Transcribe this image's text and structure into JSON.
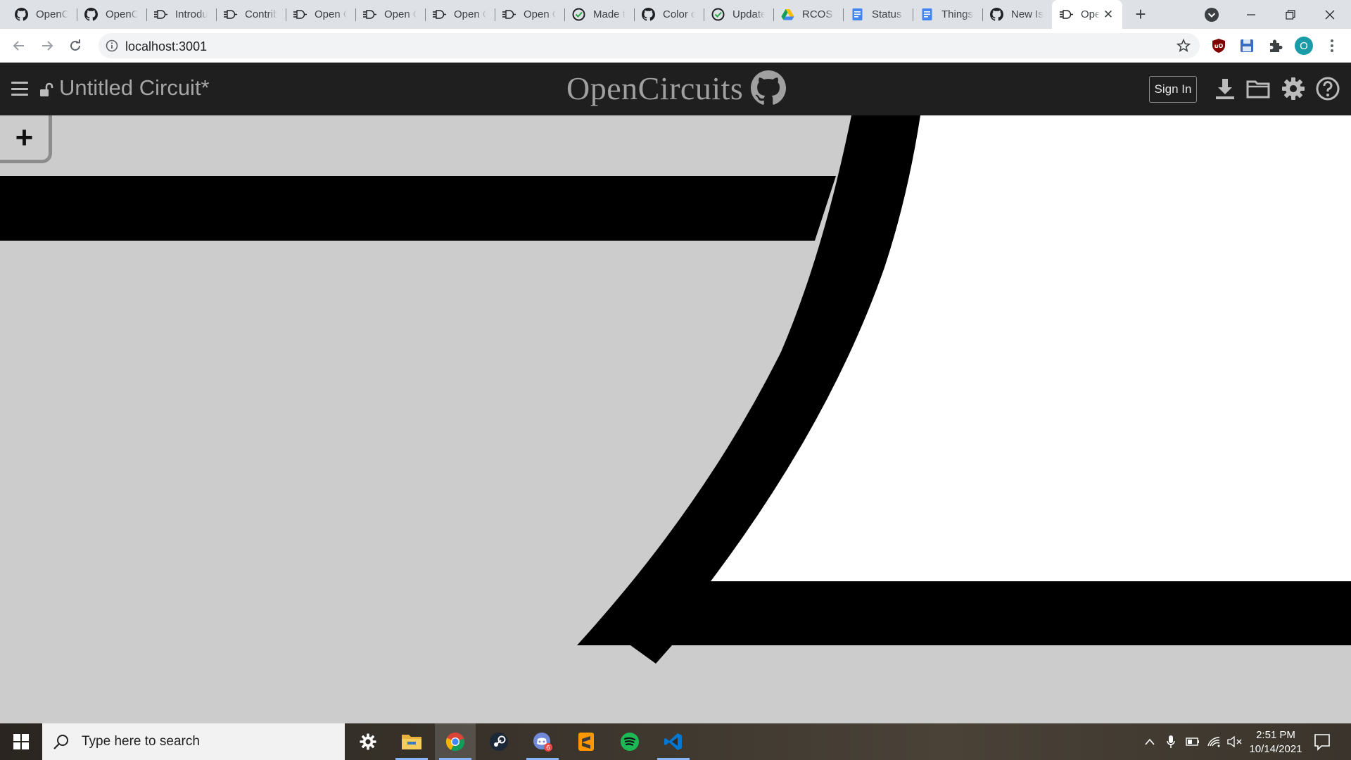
{
  "browser": {
    "tabs": [
      {
        "title": "OpenCircuits",
        "icon": "github-icon"
      },
      {
        "title": "OpenCircuits",
        "icon": "github-icon"
      },
      {
        "title": "Introduction",
        "icon": "gate-icon"
      },
      {
        "title": "Contributing",
        "icon": "gate-icon"
      },
      {
        "title": "Open Circuits",
        "icon": "gate-icon"
      },
      {
        "title": "Open Circuits",
        "icon": "gate-icon"
      },
      {
        "title": "Open Circuits",
        "icon": "gate-icon"
      },
      {
        "title": "Open Circuits",
        "icon": "gate-icon"
      },
      {
        "title": "Made this",
        "icon": "github-check-icon"
      },
      {
        "title": "Color coding",
        "icon": "github-icon"
      },
      {
        "title": "Update",
        "icon": "github-check-icon"
      },
      {
        "title": "RCOS -",
        "icon": "drive-icon"
      },
      {
        "title": "Status Update",
        "icon": "docs-icon"
      },
      {
        "title": "Things",
        "icon": "docs-icon"
      },
      {
        "title": "New Issue",
        "icon": "github-icon"
      },
      {
        "title": "OpenCircuits",
        "icon": "gate-icon",
        "active": true
      }
    ],
    "new_tab_label": "+",
    "address": "localhost:3001"
  },
  "app": {
    "circuit_name": "Untitled Circuit*",
    "brand": "OpenCircuits",
    "sign_in_label": "Sign In",
    "add_button_label": "+"
  },
  "taskbar": {
    "search_placeholder": "Type here to search",
    "time": "2:51 PM",
    "date": "10/14/2021",
    "discord_badge": "6"
  },
  "colors": {
    "header_bg": "#1f1f1f",
    "canvas_bg": "#cccccc",
    "gate_fill": "#ffffff",
    "wire": "#000000"
  }
}
